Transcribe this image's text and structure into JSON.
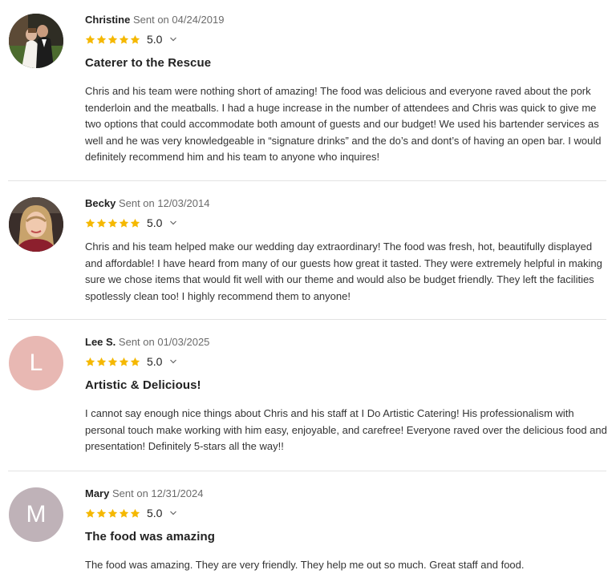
{
  "colors": {
    "star": "#f5b800",
    "avatar_lee": "#e8b8b3",
    "avatar_mary": "#bfb2b8"
  },
  "reviews": [
    {
      "name": "Christine",
      "sent": "Sent on 04/24/2019",
      "rating": 5,
      "rating_label": "5.0",
      "title": "Caterer to the Rescue",
      "body": "Chris and his team were nothing short of amazing! The food was delicious and everyone raved about the pork tenderloin and the meatballs. I had a huge increase in the number of attendees and Chris was quick to give me two options that could accommodate both amount of guests and our budget! We used his bartender services as well and he was very knowledgeable in “signature drinks” and the do’s and dont’s of having an open bar. I would definitely recommend him and his team to anyone who inquires!",
      "avatar": "photo-couple"
    },
    {
      "name": "Becky",
      "sent": "Sent on 12/03/2014",
      "rating": 5,
      "rating_label": "5.0",
      "title": "",
      "body": "Chris and his team helped make our wedding day extraordinary! The food was fresh, hot, beautifully displayed and affordable! I have heard from many of our guests how great it tasted. They were extremely helpful in making sure we chose items that would fit well with our theme and would also be budget friendly. They left the facilities spotlessly clean too! I highly recommend them to anyone!",
      "avatar": "photo-woman"
    },
    {
      "name": "Lee S.",
      "sent": "Sent on 01/03/2025",
      "rating": 5,
      "rating_label": "5.0",
      "title": "Artistic & Delicious!",
      "body": "I cannot say enough nice things about Chris and his staff at I Do Artistic Catering! His professionalism with personal touch make working with him easy, enjoyable, and carefree! Everyone raved over the delicious food and presentation! Definitely 5-stars all the way!!",
      "avatar_initial": "L"
    },
    {
      "name": "Mary",
      "sent": "Sent on 12/31/2024",
      "rating": 5,
      "rating_label": "5.0",
      "title": "The food was amazing",
      "body": "The food was amazing. They are very friendly. They help me out so much. Great staff and food.",
      "avatar_initial": "M"
    }
  ]
}
